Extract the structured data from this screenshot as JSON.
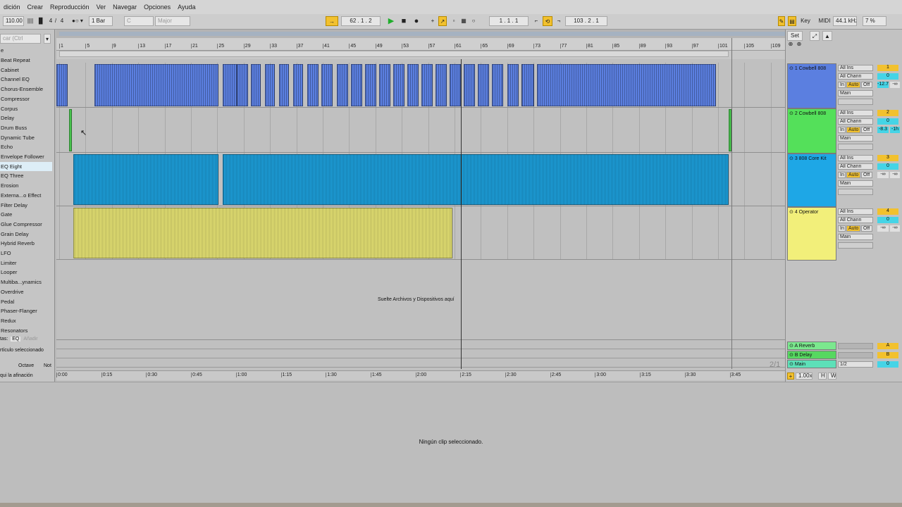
{
  "menu": [
    "dición",
    "Crear",
    "Reproducción",
    "Ver",
    "Navegar",
    "Opciones",
    "Ayuda"
  ],
  "transport": {
    "tempo": "110.00",
    "signature_num": "4",
    "signature_den": "4",
    "quantize": "1 Bar",
    "key": "C",
    "scale": "Major",
    "position": "62 .  1 .  2",
    "loop_start": "1 .  1 .  1",
    "loop_length": "103 .  2 .  1",
    "key_label": "Key",
    "midi_label": "MIDI",
    "sample_rate": "44.1 kHz",
    "cpu": "7 %"
  },
  "browser": {
    "search_placeholder": "car (Ctrl",
    "header": "e",
    "items": [
      "Beat Repeat",
      "Cabinet",
      "Channel EQ",
      "Chorus-Ensemble",
      "Compressor",
      "Corpus",
      "Delay",
      "Drum Buss",
      "Dynamic Tube",
      "Echo",
      "Envelope Follower",
      "EQ Eight",
      "EQ Three",
      "Erosion",
      "Externa...o Effect",
      "Filter Delay",
      "Gate",
      "Glue Compressor",
      "Grain Delay",
      "Hybrid Reverb",
      "LFO",
      "Limiter",
      "Looper",
      "Multiba...ynamics",
      "Overdrive",
      "Pedal",
      "Phaser-Flanger",
      "Redux",
      "Resonators"
    ],
    "selected_index": 11,
    "tags_label": "tas:",
    "tag_active": "EQ",
    "tag_add": "Añadir",
    "selected_article": "rtículo seleccionado",
    "octave_label": "Octave",
    "note_label": "Not",
    "tuning_hint": "qui la afinación"
  },
  "ruler": {
    "bars": [
      "1",
      "5",
      "9",
      "13",
      "17",
      "21",
      "25",
      "29",
      "33",
      "37",
      "41",
      "45",
      "49",
      "53",
      "57",
      "61",
      "65",
      "69",
      "73",
      "77",
      "81",
      "85",
      "89",
      "93",
      "97",
      "101",
      "105",
      "109"
    ],
    "times": [
      "0:00",
      "0:15",
      "0:30",
      "0:45",
      "1:00",
      "1:15",
      "1:30",
      "1:45",
      "2:00",
      "2:15",
      "2:30",
      "2:45",
      "3:00",
      "3:15",
      "3:30",
      "3:45"
    ]
  },
  "tracks": [
    {
      "name": "1 Cowbell 808",
      "color": "#5b7fe0",
      "input": "All Ins",
      "channel": "All Chann",
      "number": "1",
      "send": "0",
      "vol": "-12.7",
      "pan": "-∞",
      "out": "Main"
    },
    {
      "name": "2 Cowbell 808",
      "color": "#54e05a",
      "input": "All Ins",
      "channel": "All Chann",
      "number": "2",
      "send": "0",
      "vol": "-8.3",
      "pan": "-1h",
      "out": "Main"
    },
    {
      "name": "3 808 Core Kit",
      "color": "#1ea7e6",
      "input": "All Ins",
      "channel": "All Chann",
      "number": "3",
      "send": "0",
      "vol": "-∞",
      "pan": "-∞",
      "out": "Main"
    },
    {
      "name": "4 Operator",
      "color": "#f2ef7a",
      "input": "All Ins",
      "channel": "All Chann",
      "number": "4",
      "send": "0",
      "vol": "-∞",
      "pan": "-∞",
      "out": "Main"
    }
  ],
  "monitor": {
    "in": "In",
    "auto": "Auto",
    "off": "Off"
  },
  "returns": [
    {
      "name": "A Reverb",
      "label": "A"
    },
    {
      "name": "B Delay",
      "label": "B"
    }
  ],
  "main": {
    "name": "Main",
    "output": "1/2",
    "value": "0"
  },
  "set_label": "Set",
  "drop_hint": "Suelte Archivos y Dispositivos aquí",
  "page_indicator": "2/1",
  "zoom": "1.00x",
  "h_label": "H",
  "w_label": "W",
  "detail_message": "Ningún clip seleccionado."
}
